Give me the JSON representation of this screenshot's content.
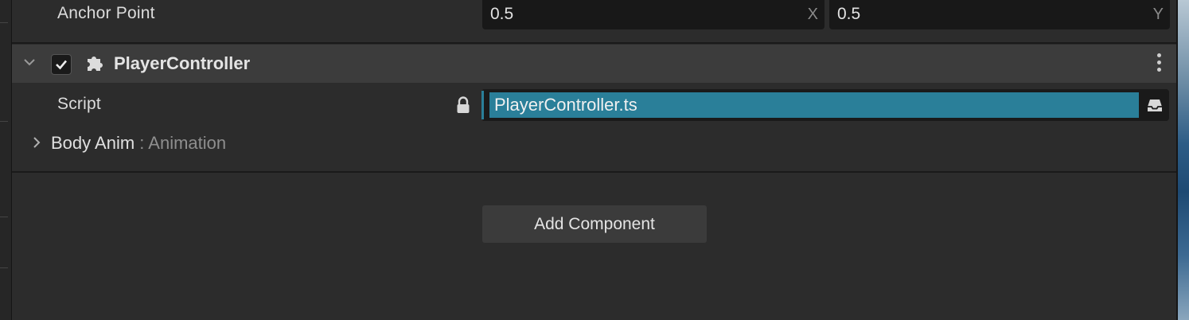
{
  "anchor_point": {
    "label": "Anchor Point",
    "x_value": "0.5",
    "x_axis": "X",
    "y_value": "0.5",
    "y_axis": "Y"
  },
  "component": {
    "name": "PlayerController",
    "enabled": true,
    "script_label": "Script",
    "script_value": "PlayerController.ts",
    "property_name": "Body Anim",
    "property_type": ": Animation"
  },
  "actions": {
    "add_component": "Add Component"
  },
  "colors": {
    "script_highlight": "#2a7f99",
    "panel_bg": "#2c2c2c",
    "header_bg": "#3c3c3c"
  }
}
